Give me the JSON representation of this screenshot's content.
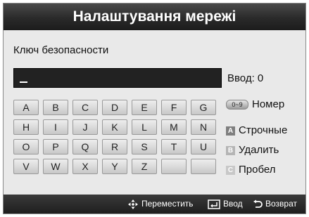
{
  "dialog": {
    "title": "Налаштування мережі"
  },
  "security_key": {
    "label": "Ключ безопасности",
    "value": "",
    "count_label": "Ввод: 0"
  },
  "keyboard": {
    "rows": [
      [
        "A",
        "B",
        "C",
        "D",
        "E",
        "F",
        "G"
      ],
      [
        "H",
        "I",
        "J",
        "K",
        "L",
        "M",
        "N"
      ],
      [
        "O",
        "P",
        "Q",
        "R",
        "S",
        "T",
        "U"
      ],
      [
        "V",
        "W",
        "X",
        "Y",
        "Z",
        "",
        ""
      ]
    ]
  },
  "side_actions": {
    "number": {
      "badge": "0~9",
      "label": "Номер"
    },
    "lowercase": {
      "badge": "A",
      "label": "Строчные",
      "color": "#7f7f7f"
    },
    "delete": {
      "badge": "B",
      "label": "Удалить",
      "color": "#b5b5b5"
    },
    "space": {
      "badge": "C",
      "label": "Пробел",
      "color": "#c8c8c8"
    }
  },
  "footer": {
    "move": "Переместить",
    "enter": "Ввод",
    "return": "Возврат"
  }
}
